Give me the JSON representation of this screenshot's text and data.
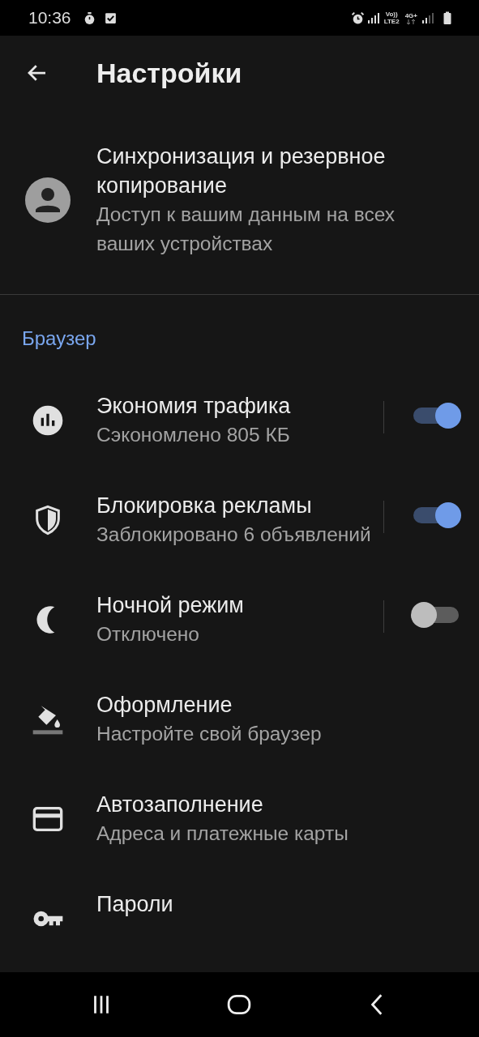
{
  "status_bar": {
    "time": "10:36",
    "volte": "Vo))",
    "lte": "LTE2",
    "network": "4G+"
  },
  "app_bar": {
    "title": "Настройки"
  },
  "account": {
    "title": "Синхронизация и резервное копирование",
    "subtitle": "Доступ к вашим данным на всех ваших устройствах"
  },
  "section": {
    "title": "Браузер"
  },
  "items": [
    {
      "kind": "switch",
      "title": "Экономия трафика",
      "subtitle": "Сэкономлено 805 КБ",
      "on": true
    },
    {
      "kind": "switch",
      "title": "Блокировка рекламы",
      "subtitle": "Заблокировано 6 объявлений",
      "on": true
    },
    {
      "kind": "switch",
      "title": "Ночной режим",
      "subtitle": "Отключено",
      "on": false
    },
    {
      "kind": "link",
      "title": "Оформление",
      "subtitle": "Настройте свой браузер"
    },
    {
      "kind": "link",
      "title": "Автозаполнение",
      "subtitle": "Адреса и платежные карты"
    },
    {
      "kind": "link",
      "title": "Пароли"
    }
  ]
}
